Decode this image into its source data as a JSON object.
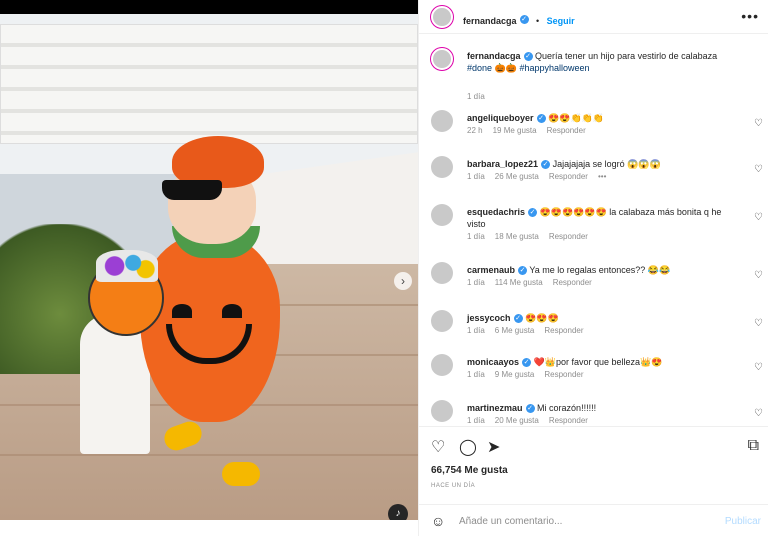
{
  "post": {
    "author": "fernandacga",
    "follow_label": "Seguir",
    "more_icon": "more-horizontal-icon",
    "caption_text": "Quería tener un hijo para vestirlo de calabaza",
    "hashtag_1": "#done",
    "caption_mid": " 🎃🎃 ",
    "hashtag_2": "#happyhalloween",
    "caption_time": "1 día",
    "likes": "66,754 Me gusta",
    "posted_ago": "HACE UN DÍA"
  },
  "comments": [
    {
      "user": "angeliqueboyer",
      "text": "😍😍👏👏👏",
      "time": "22 h",
      "likes": "19 Me gusta",
      "reply": "Responder"
    },
    {
      "user": "barbara_lopez21",
      "text": "Jajajajaja se logró 😱😱😱",
      "time": "1 día",
      "likes": "26 Me gusta",
      "reply": "Responder",
      "extra": "•••"
    },
    {
      "user": "esquedachris",
      "text": "😍😍😍😍😍😍 la calabaza más bonita q he visto",
      "time": "1 día",
      "likes": "18 Me gusta",
      "reply": "Responder"
    },
    {
      "user": "carmenaub",
      "text": "Ya me lo regalas entonces?? 😂😂",
      "time": "1 día",
      "likes": "114 Me gusta",
      "reply": "Responder"
    },
    {
      "user": "jessycoch",
      "text": "😍😍😍",
      "time": "1 día",
      "likes": "6 Me gusta",
      "reply": "Responder"
    },
    {
      "user": "monicaayos",
      "text": "❤️👑por favor que belleza👑😍",
      "time": "1 día",
      "likes": "9 Me gusta",
      "reply": "Responder"
    },
    {
      "user": "martinezmau",
      "text": "Mi corazón!!!!!!",
      "time": "1 día",
      "likes": "20 Me gusta",
      "reply": "Responder"
    }
  ],
  "add_comment": {
    "placeholder": "Añade un comentario...",
    "publish": "Publicar"
  },
  "colors": {
    "accent": "#0095f6",
    "verified": "#3897f0",
    "muted_text": "#8e8e8e"
  }
}
